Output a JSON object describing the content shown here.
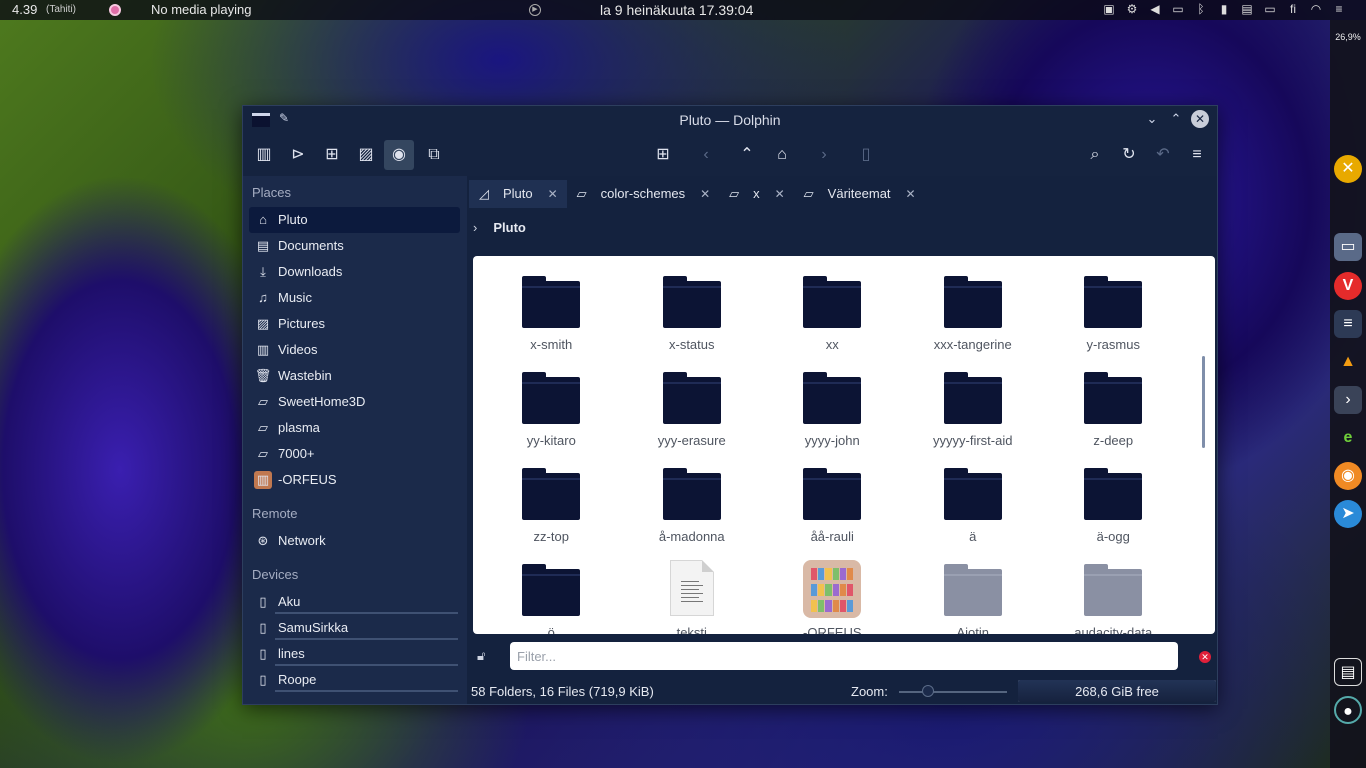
{
  "panel": {
    "clock": "4.39",
    "timezone": "(Tahiti)",
    "media": "No media playing",
    "date": "la 9 heinäkuuta 17.39:04",
    "keyboard_layout": "fi"
  },
  "dock": {
    "battery": "26,9%"
  },
  "window": {
    "title": "Pluto — Dolphin"
  },
  "sidebar": {
    "places_header": "Places",
    "places": [
      {
        "label": "Pluto",
        "icon": "home-icon"
      },
      {
        "label": "Documents",
        "icon": "documents-icon"
      },
      {
        "label": "Downloads",
        "icon": "downloads-icon"
      },
      {
        "label": "Music",
        "icon": "music-icon"
      },
      {
        "label": "Pictures",
        "icon": "pictures-icon"
      },
      {
        "label": "Videos",
        "icon": "videos-icon"
      },
      {
        "label": "Wastebin",
        "icon": "trash-icon"
      },
      {
        "label": "SweetHome3D",
        "icon": "folder-icon"
      },
      {
        "label": "plasma",
        "icon": "folder-icon"
      },
      {
        "label": "7000+",
        "icon": "folder-icon"
      },
      {
        "label": "-ORFEUS",
        "icon": "bookshelf-icon"
      }
    ],
    "remote_header": "Remote",
    "remote": [
      {
        "label": "Network",
        "icon": "network-icon"
      }
    ],
    "devices_header": "Devices",
    "devices": [
      {
        "label": "Aku",
        "icon": "phone-icon"
      },
      {
        "label": "SamuSirkka",
        "icon": "drive-icon"
      },
      {
        "label": "lines",
        "icon": "drive-icon"
      },
      {
        "label": "Roope",
        "icon": "drive-icon"
      }
    ]
  },
  "tabs": [
    {
      "label": "Pluto",
      "active": true
    },
    {
      "label": "color-schemes",
      "active": false
    },
    {
      "label": "x",
      "active": false
    },
    {
      "label": "Väriteemat",
      "active": false
    }
  ],
  "breadcrumb": "Pluto",
  "files": [
    {
      "name": "x-smith",
      "type": "folder"
    },
    {
      "name": "x-status",
      "type": "folder"
    },
    {
      "name": "xx",
      "type": "folder"
    },
    {
      "name": "xxx-tangerine",
      "type": "folder"
    },
    {
      "name": "y-rasmus",
      "type": "folder"
    },
    {
      "name": "yy-kitaro",
      "type": "folder"
    },
    {
      "name": "yyy-erasure",
      "type": "folder"
    },
    {
      "name": "yyyy-john",
      "type": "folder"
    },
    {
      "name": "yyyyy-first-aid",
      "type": "folder"
    },
    {
      "name": "z-deep",
      "type": "folder"
    },
    {
      "name": "zz-top",
      "type": "folder"
    },
    {
      "name": "å-madonna",
      "type": "folder"
    },
    {
      "name": "åå-rauli",
      "type": "folder"
    },
    {
      "name": "ä",
      "type": "folder"
    },
    {
      "name": "ä-ogg",
      "type": "folder"
    },
    {
      "name": "ö",
      "type": "folder"
    },
    {
      "name": "teksti",
      "type": "document"
    },
    {
      "name": "-ORFEUS",
      "type": "bookshelf"
    },
    {
      "name": "Aiotin",
      "type": "folder-hidden"
    },
    {
      "name": "audacity-data",
      "type": "folder-hidden"
    }
  ],
  "filter": {
    "placeholder": "Filter..."
  },
  "status": {
    "summary": "58 Folders, 16 Files (719,9 KiB)",
    "zoom_label": "Zoom:",
    "free_space": "268,6 GiB free"
  }
}
